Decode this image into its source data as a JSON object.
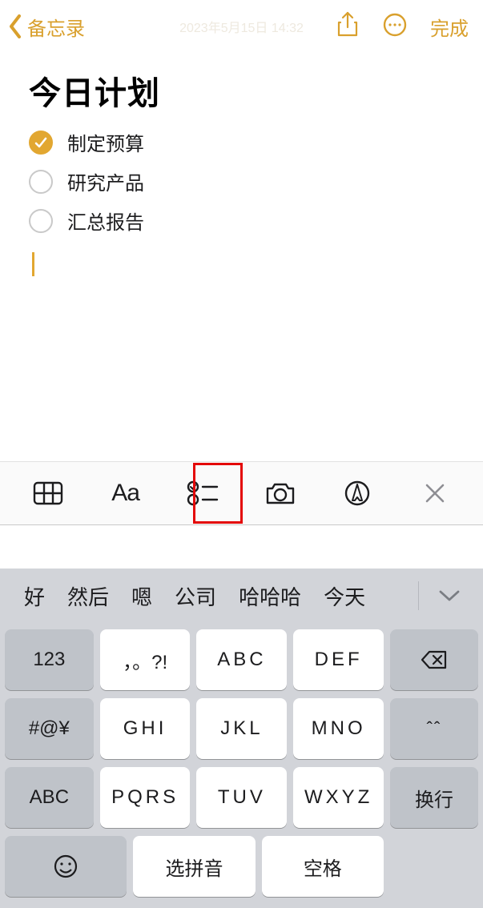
{
  "nav": {
    "back_label": "备忘录",
    "timestamp": "2023年5月15日 14:32",
    "done_label": "完成"
  },
  "note": {
    "title": "今日计划",
    "items": [
      {
        "checked": true,
        "text": "制定预算"
      },
      {
        "checked": false,
        "text": "研究产品"
      },
      {
        "checked": false,
        "text": "汇总报告"
      }
    ]
  },
  "toolbar": {
    "aa": "Aa"
  },
  "suggestions": [
    "好",
    "然后",
    "嗯",
    "公司",
    "哈哈哈",
    "今天"
  ],
  "keyboard": {
    "left": [
      "123",
      "#@¥",
      "ABC"
    ],
    "grid": [
      [
        "，。?!",
        "ABC",
        "DEF"
      ],
      [
        "GHI",
        "JKL",
        "MNO"
      ],
      [
        "PQRS",
        "TUV",
        "WXYZ"
      ]
    ],
    "right_top": "⌫",
    "right_mid": "ˆˆ",
    "right_bottom": "换行",
    "pick": "选拼音",
    "space": "空格"
  }
}
